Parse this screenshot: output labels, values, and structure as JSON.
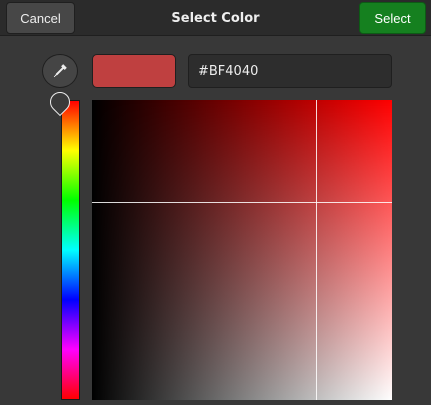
{
  "header": {
    "title": "Select Color",
    "cancel_label": "Cancel",
    "select_label": "Select"
  },
  "editor": {
    "hex_value": "#BF4040",
    "selected_color": "#BF4040",
    "hue_color": "#FF0000",
    "hue_fraction": 0.0,
    "saturation_fraction": 0.75,
    "value_fraction": 0.66
  },
  "icons": {
    "eyedropper": "eyedropper-icon"
  },
  "colors": {
    "accent": "#15801F",
    "background": "#383838",
    "headerbar": "#2B2B2B"
  }
}
